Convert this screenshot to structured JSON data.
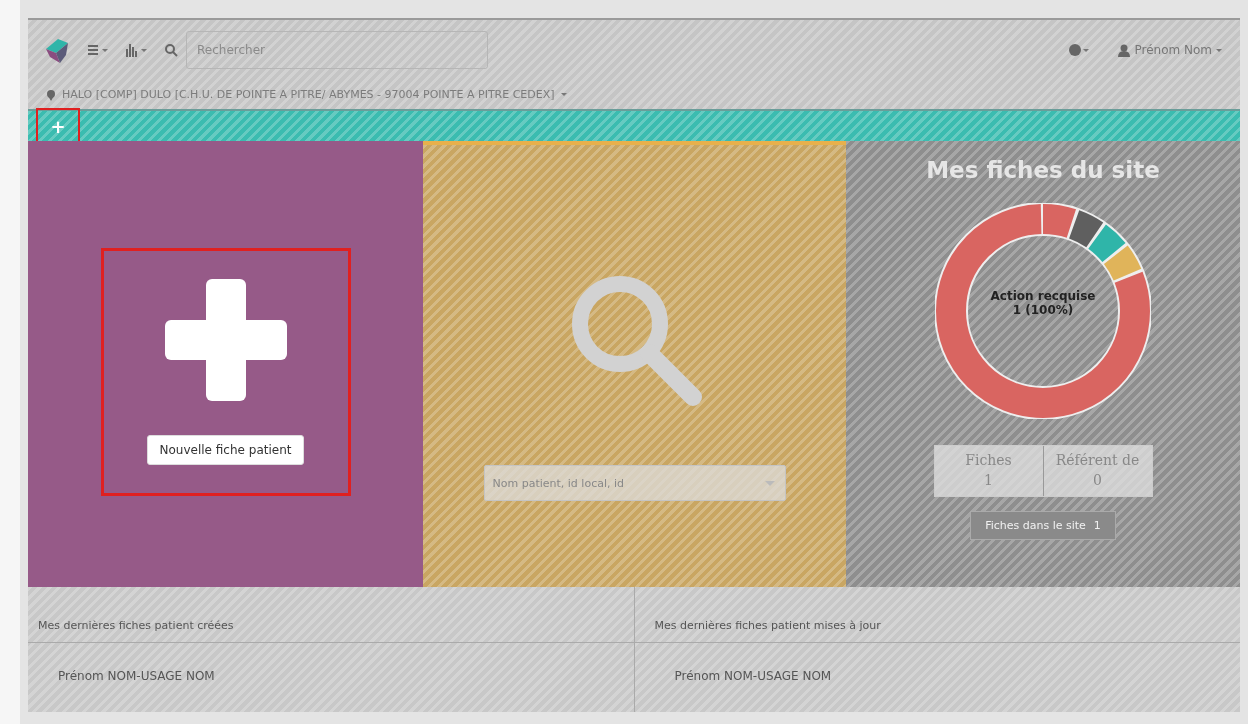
{
  "toolbar": {
    "search": {
      "placeholder": "Rechercher"
    },
    "user": {
      "name": "Prénom Nom"
    }
  },
  "location": {
    "text": "HALO [COMP] DULO [C.H.U. DE POINTE A PITRE/ ABYMES - 97004 POINTE A PITRE CEDEX]"
  },
  "action_bar": {
    "buttons": [
      {
        "label": "+",
        "highlighted": true
      }
    ]
  },
  "tiles": [
    {
      "kind": "create",
      "button": "Nouvelle fiche patient",
      "highlighted": true
    },
    {
      "kind": "search",
      "placeholder": "Nom patient, id local, id"
    },
    {
      "kind": "stats",
      "title": "Mes fiches du site",
      "donut_label": "Action recquise",
      "donut_value": "1 (100%)",
      "stats": [
        {
          "label": "Fiches",
          "value": "1"
        },
        {
          "label": "Référent de",
          "value": "0"
        }
      ],
      "site_button": {
        "label": "Fiches dans le site",
        "count": "1"
      }
    }
  ],
  "recent": [
    {
      "title": "Mes dernières fiches patient créées",
      "items": [
        "Prénom NOM-USAGE NOM"
      ]
    },
    {
      "title": "Mes dernières fiches patient mises à jour",
      "items": [
        "Prénom NOM-USAGE NOM"
      ]
    }
  ]
}
